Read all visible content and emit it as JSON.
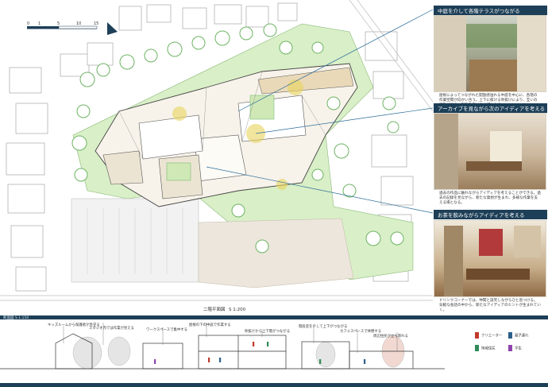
{
  "plan": {
    "title": "二階平面図",
    "scale": "S 1:200",
    "scale_bar_labels": [
      "0",
      "1",
      "5",
      "10",
      "15"
    ]
  },
  "perspectives": [
    {
      "heading": "中庭を介して各階テラスがつながる",
      "caption": "屋根によってつながれた開放感溢れる中庭を中心に、各階の作業空間が向かい合う。上下に抜ける吹抜けにより、互いの活動が見え、刺激を受け合う場となる。"
    },
    {
      "heading": "アーカイブを見ながら次のアイディアを考える",
      "caption": "過去の作品に触れながらアイディアを考えることができる。過去の記録を見ながら、新たな発想が生まれ、多様な作業を支える場となる。"
    },
    {
      "heading": "お茶を飲みながらアイディアを考える",
      "caption": "ドリンクコーナーでは、仲間と談笑しながらひと息つける。気軽な会話の中から、新たなアイディアのヒントが生まれていく。"
    }
  ],
  "section": {
    "title": "断面図",
    "scale": "S 1:150",
    "annotations": [
      "キッズルームから保護者が見守る",
      "スタジオ内では作業が見える",
      "ワークスペースで集中する",
      "屋根の下の中庭で作業する",
      "吹抜けから上下階がつながる",
      "階段室を介して上下がつながる",
      "カフェスペースで休憩する",
      "周辺住民が立ち寄れる"
    ]
  },
  "legend": {
    "items": [
      {
        "label": "クリエーター",
        "color": "#c0392b"
      },
      {
        "label": "親子連れ",
        "color": "#2c5f8a"
      },
      {
        "label": "地域住民",
        "color": "#2e8b57"
      },
      {
        "label": "学生",
        "color": "#8e44ad"
      }
    ]
  },
  "colors": {
    "header_bar": "#1d3f57",
    "lawn": "#d9efc7",
    "tree_outline": "#6db363",
    "accent_yellow": "#e8d35c"
  }
}
